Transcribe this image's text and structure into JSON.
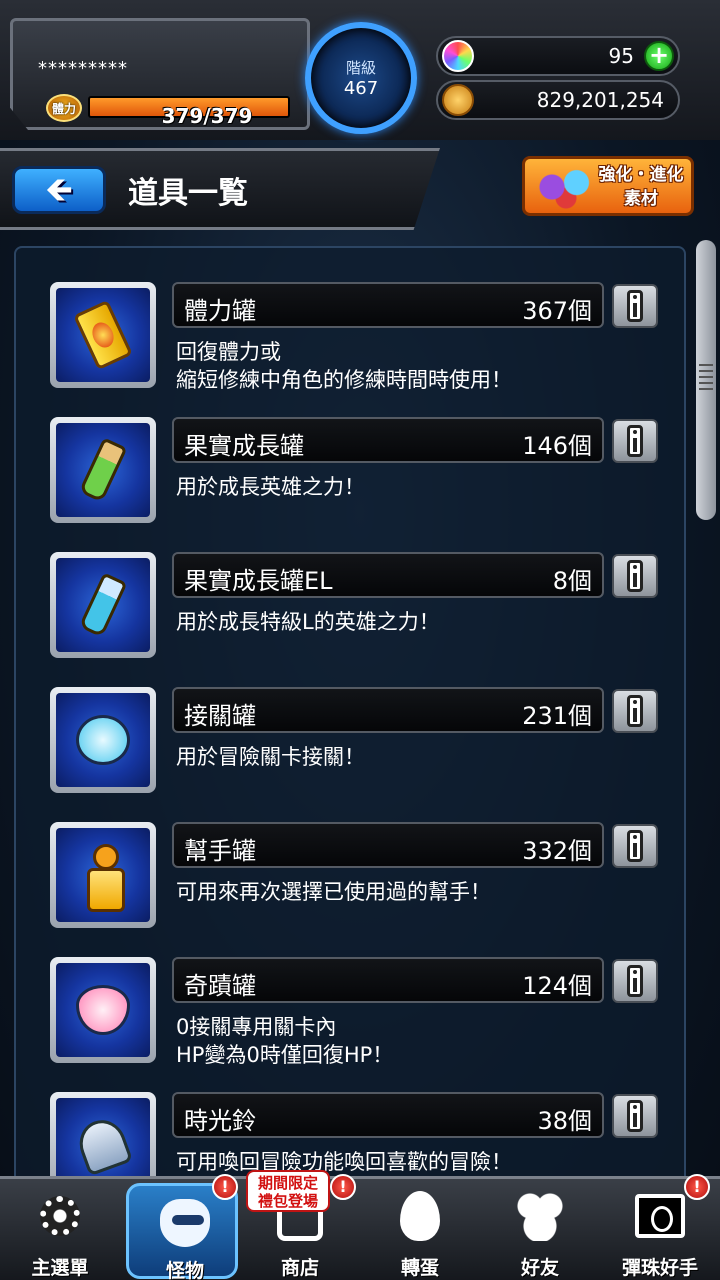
{
  "header": {
    "player_name": "*********",
    "stamina_label": "體力",
    "stamina_text": "379/379",
    "stamina_fraction": 1.0,
    "rank_label": "階級",
    "rank_value": "467",
    "orbs": "95",
    "coins": "829,201,254",
    "plus_symbol": "+"
  },
  "titlebar": {
    "back_symbol": "🡸",
    "title": "道具一覧",
    "materials_label_line1": "強化・進化",
    "materials_label_line2": "素材"
  },
  "items": [
    {
      "name": "體力罐",
      "count": "367個",
      "desc": "回復體力或\n縮短修練中角色的修練時間時使用！",
      "icon": "stamina-can-icon"
    },
    {
      "name": "果實成長罐",
      "count": "146個",
      "desc": "用於成長英雄之力！",
      "icon": "fruit-growth-bottle-icon"
    },
    {
      "name": "果實成長罐EL",
      "count": "8個",
      "desc": "用於成長特級L的英雄之力！",
      "icon": "fruit-growth-el-bottle-icon"
    },
    {
      "name": "接關罐",
      "count": "231個",
      "desc": "用於冒險關卡接關！",
      "icon": "continue-jar-icon"
    },
    {
      "name": "幫手罐",
      "count": "332個",
      "desc": "可用來再次選擇已使用過的幫手！",
      "icon": "helper-jar-icon"
    },
    {
      "name": "奇蹟罐",
      "count": "124個",
      "desc": "0接關專用關卡內\nHP變為0時僅回復HP！",
      "icon": "miracle-jar-icon"
    },
    {
      "name": "時光鈴",
      "count": "38個",
      "desc": "可用喚回冒險功能喚回喜歡的冒險！",
      "icon": "time-bell-icon"
    }
  ],
  "nav": {
    "items": [
      {
        "label": "主選單",
        "icon": "main-menu-icon"
      },
      {
        "label": "怪物",
        "icon": "monster-icon"
      },
      {
        "label": "商店",
        "icon": "shop-cart-icon"
      },
      {
        "label": "轉蛋",
        "icon": "gacha-egg-icon"
      },
      {
        "label": "好友",
        "icon": "friends-icon"
      },
      {
        "label": "彈珠好手",
        "icon": "marble-card-icon"
      }
    ],
    "alert_symbol": "!",
    "promo_line1": "期間限定",
    "promo_line2": "禮包登場"
  },
  "colors": {
    "accent_blue": "#3fa0ff",
    "stamina_orange": "#ff9a2a",
    "alert_red": "#d21010"
  }
}
